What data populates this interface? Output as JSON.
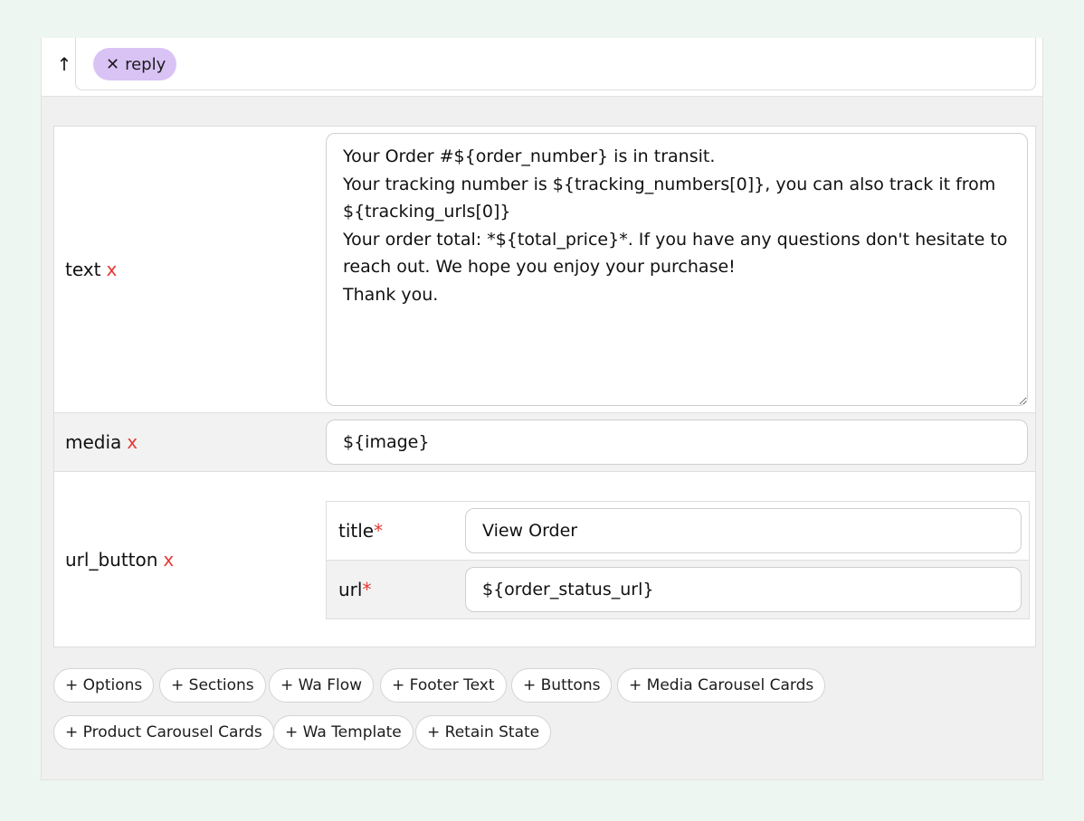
{
  "reply_chip": {
    "close_icon": "close-icon",
    "label": "reply"
  },
  "arrow_icon": "arrow-up-icon",
  "fields": {
    "text": {
      "label": "text",
      "remove": "x",
      "value": "Your Order #${order_number} is in transit.\nYour tracking number is ${tracking_numbers[0]}, you can also track it from ${tracking_urls[0]}\nYour order total: *${total_price}*. If you have any questions don't hesitate to reach out. We hope you enjoy your purchase!\nThank you."
    },
    "media": {
      "label": "media",
      "remove": "x",
      "value": "${image}"
    },
    "url_button": {
      "label": "url_button",
      "remove": "x",
      "title": {
        "label": "title",
        "required": "*",
        "value": "View Order"
      },
      "url": {
        "label": "url",
        "required": "*",
        "value": "${order_status_url}"
      }
    }
  },
  "add_buttons": [
    "+ Options",
    "+ Sections",
    "+ Wa Flow",
    "+ Footer Text",
    "+ Buttons",
    "+ Media Carousel Cards",
    "+ Product Carousel Cards",
    "+ Wa Template",
    "+ Retain State"
  ],
  "colors": {
    "chip_bg": "#d9c3f5",
    "required": "#e53935",
    "background": "#eef6f1"
  }
}
